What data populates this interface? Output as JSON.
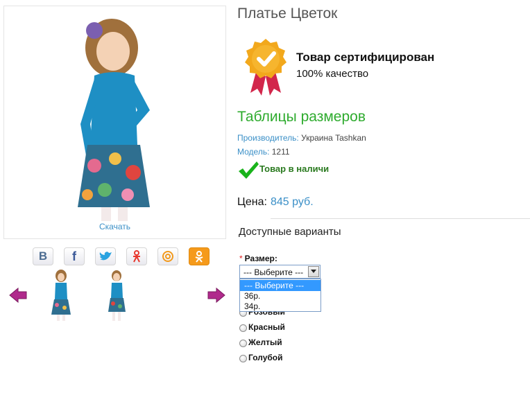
{
  "product": {
    "title": "Платье Цветок",
    "download_label": "Скачать"
  },
  "certificate": {
    "title": "Товар сертифицирован",
    "subtitle": "100% качество"
  },
  "size_table_link": "Таблицы размеров",
  "meta": {
    "manufacturer_label": "Производитель:",
    "manufacturer_value": "Украина Tashkan",
    "model_label": "Модель:",
    "model_value": "1211"
  },
  "stock_status": "Товар в наличи",
  "price": {
    "label": "Цена:",
    "value": "845 руб."
  },
  "variants": {
    "title": "Доступные варианты",
    "required_mark": "*",
    "size_label": "Размер:",
    "size_selected": "--- Выберите ---",
    "size_options": [
      "--- Выберите ---",
      "36р.",
      "34р."
    ],
    "colors": [
      "Розовый",
      "Красный",
      "Желтый",
      "Голубой"
    ]
  },
  "share_icons": [
    "vk-icon",
    "facebook-icon",
    "twitter-icon",
    "odnoklassniki-icon",
    "mail-ru-icon",
    "ok-icon"
  ],
  "colors": {
    "accent_blue": "#3a8fc7",
    "green_link": "#2eab2e",
    "in_stock": "#2a7a1f",
    "badge_gold": "#f2a81c",
    "ribbon_red": "#d2264b",
    "nav_arrow": "#b02a8c"
  }
}
